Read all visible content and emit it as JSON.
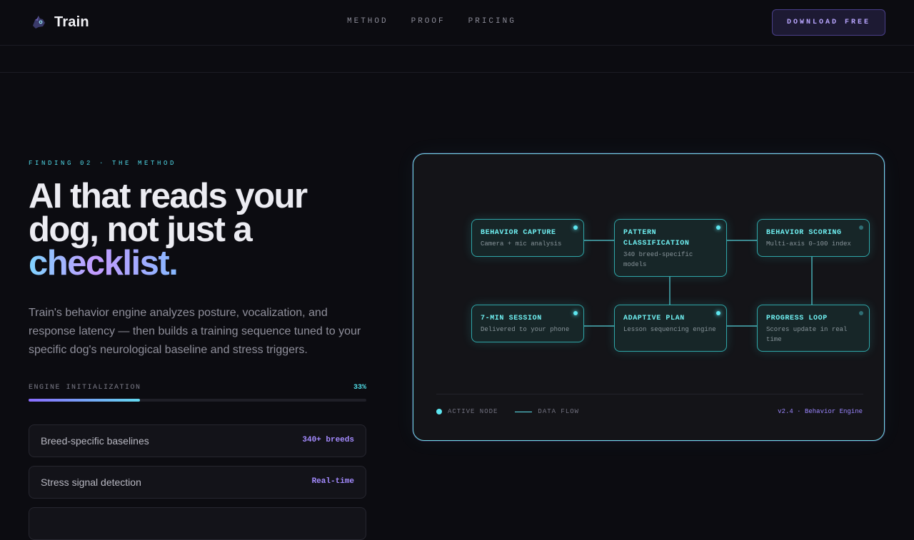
{
  "header": {
    "brand": "Train",
    "nav": [
      "METHOD",
      "PROOF",
      "PRICING"
    ],
    "cta": "DOWNLOAD FREE"
  },
  "hero": {
    "eyebrow": "FINDING 02 · THE METHOD",
    "headline_line1": "AI that reads your",
    "headline_line2": "dog, not just a",
    "headline_accent": "checklist.",
    "description": "Train's behavior engine analyzes posture, vocalization, and response latency — then builds a training sequence tuned to your specific dog's neurological baseline and stress triggers."
  },
  "progress": {
    "label": "ENGINE INITIALIZATION",
    "value_text": "33%",
    "fraction": 0.33
  },
  "features": [
    {
      "name": "Breed-specific baselines",
      "value": "340+ breeds"
    },
    {
      "name": "Stress signal detection",
      "value": "Real-time"
    }
  ],
  "diagram": {
    "nodes": [
      {
        "title": "BEHAVIOR CAPTURE",
        "desc": "Camera + mic analysis",
        "active": true
      },
      {
        "title": "PATTERN CLASSIFICATION",
        "desc": "340 breed-specific models",
        "active": true
      },
      {
        "title": "BEHAVIOR SCORING",
        "desc": "Multi-axis 0–100 index",
        "active": false
      },
      {
        "title": "7-MIN SESSION",
        "desc": "Delivered to your phone",
        "active": true
      },
      {
        "title": "ADAPTIVE PLAN",
        "desc": "Lesson sequencing engine",
        "active": true
      },
      {
        "title": "PROGRESS LOOP",
        "desc": "Scores update in real time",
        "active": false
      }
    ],
    "legend_active": "ACTIVE NODE",
    "legend_flow": "DATA FLOW",
    "version": "v2.4 · Behavior Engine"
  },
  "colors": {
    "accent_cyan": "#5de6f0",
    "accent_purple": "#a48bff",
    "background": "#0c0c11"
  }
}
